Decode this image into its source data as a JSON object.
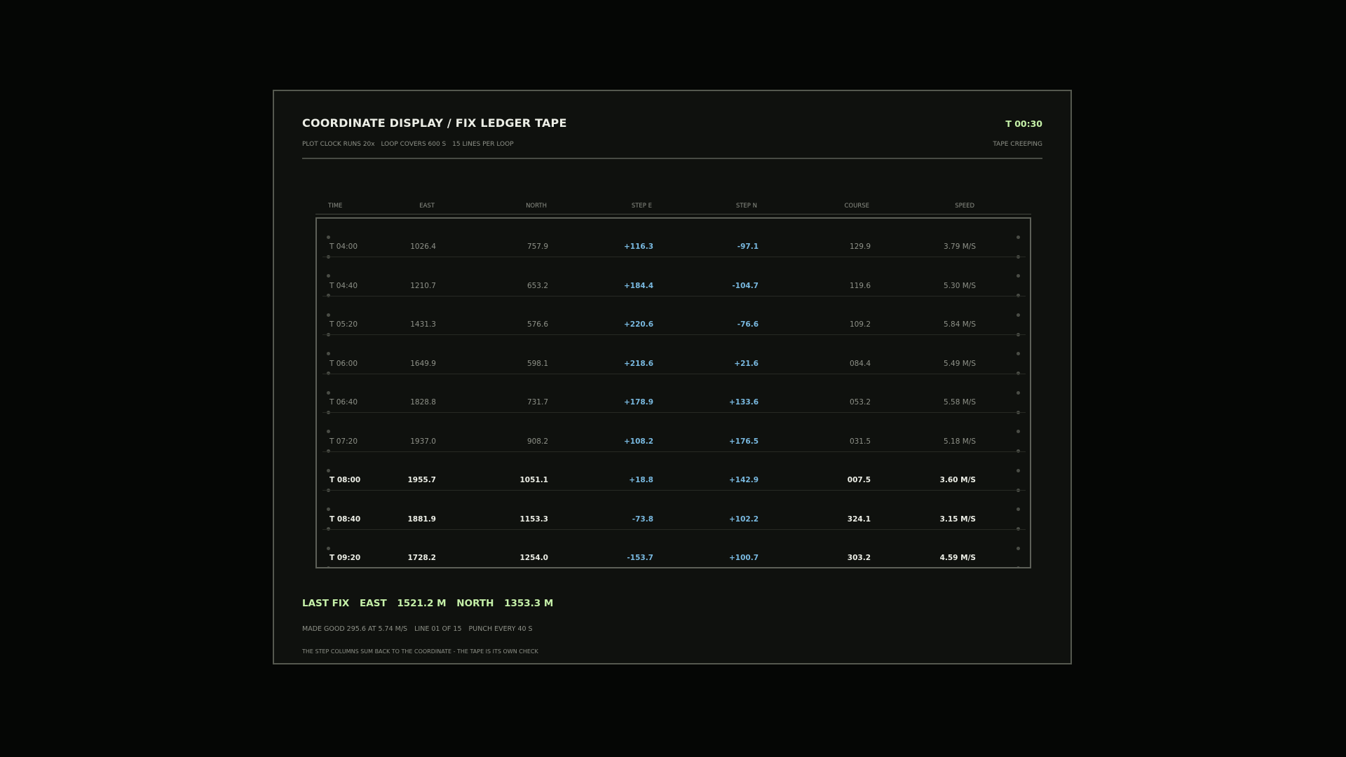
{
  "header": {
    "title": "COORDINATE DISPLAY / FIX LEDGER TAPE",
    "clock": "T 00:30",
    "subtitle": [
      "PLOT CLOCK RUNS 20x",
      "LOOP COVERS 600 S",
      "15 LINES PER LOOP"
    ],
    "state": "TAPE CREEPING"
  },
  "table": {
    "columns": [
      "TIME",
      "EAST",
      "NORTH",
      "STEP E",
      "STEP N",
      "COURSE",
      "SPEED"
    ],
    "rows": [
      {
        "time": "T 04:00",
        "east": "1026.4",
        "north": "757.9",
        "step_e": "+116.3",
        "step_n": "-97.1",
        "course": "129.9",
        "speed": "3.79 M/S",
        "recent": false
      },
      {
        "time": "T 04:40",
        "east": "1210.7",
        "north": "653.2",
        "step_e": "+184.4",
        "step_n": "-104.7",
        "course": "119.6",
        "speed": "5.30 M/S",
        "recent": false
      },
      {
        "time": "T 05:20",
        "east": "1431.3",
        "north": "576.6",
        "step_e": "+220.6",
        "step_n": "-76.6",
        "course": "109.2",
        "speed": "5.84 M/S",
        "recent": false
      },
      {
        "time": "T 06:00",
        "east": "1649.9",
        "north": "598.1",
        "step_e": "+218.6",
        "step_n": "+21.6",
        "course": "084.4",
        "speed": "5.49 M/S",
        "recent": false
      },
      {
        "time": "T 06:40",
        "east": "1828.8",
        "north": "731.7",
        "step_e": "+178.9",
        "step_n": "+133.6",
        "course": "053.2",
        "speed": "5.58 M/S",
        "recent": false
      },
      {
        "time": "T 07:20",
        "east": "1937.0",
        "north": "908.2",
        "step_e": "+108.2",
        "step_n": "+176.5",
        "course": "031.5",
        "speed": "5.18 M/S",
        "recent": false
      },
      {
        "time": "T 08:00",
        "east": "1955.7",
        "north": "1051.1",
        "step_e": "+18.8",
        "step_n": "+142.9",
        "course": "007.5",
        "speed": "3.60 M/S",
        "recent": true
      },
      {
        "time": "T 08:40",
        "east": "1881.9",
        "north": "1153.3",
        "step_e": "-73.8",
        "step_n": "+102.2",
        "course": "324.1",
        "speed": "3.15 M/S",
        "recent": true
      },
      {
        "time": "T 09:20",
        "east": "1728.2",
        "north": "1254.0",
        "step_e": "-153.7",
        "step_n": "+100.7",
        "course": "303.2",
        "speed": "4.59 M/S",
        "recent": true
      }
    ]
  },
  "last_fix": {
    "label": "LAST FIX",
    "east_label": "EAST",
    "east_value": "1521.2 M",
    "north_label": "NORTH",
    "north_value": "1353.3 M"
  },
  "status": [
    "MADE GOOD 295.6 AT 5.74 M/S",
    "LINE 01 OF 15",
    "PUNCH EVERY 40 S"
  ],
  "footnote": "THE STEP COLUMNS SUM BACK TO THE COORDINATE - THE TAPE IS ITS OWN CHECK",
  "colors": {
    "accent": "#c5f0a8",
    "step": "#79b9e0",
    "text": "#eceee6",
    "muted": "#8e9188"
  }
}
